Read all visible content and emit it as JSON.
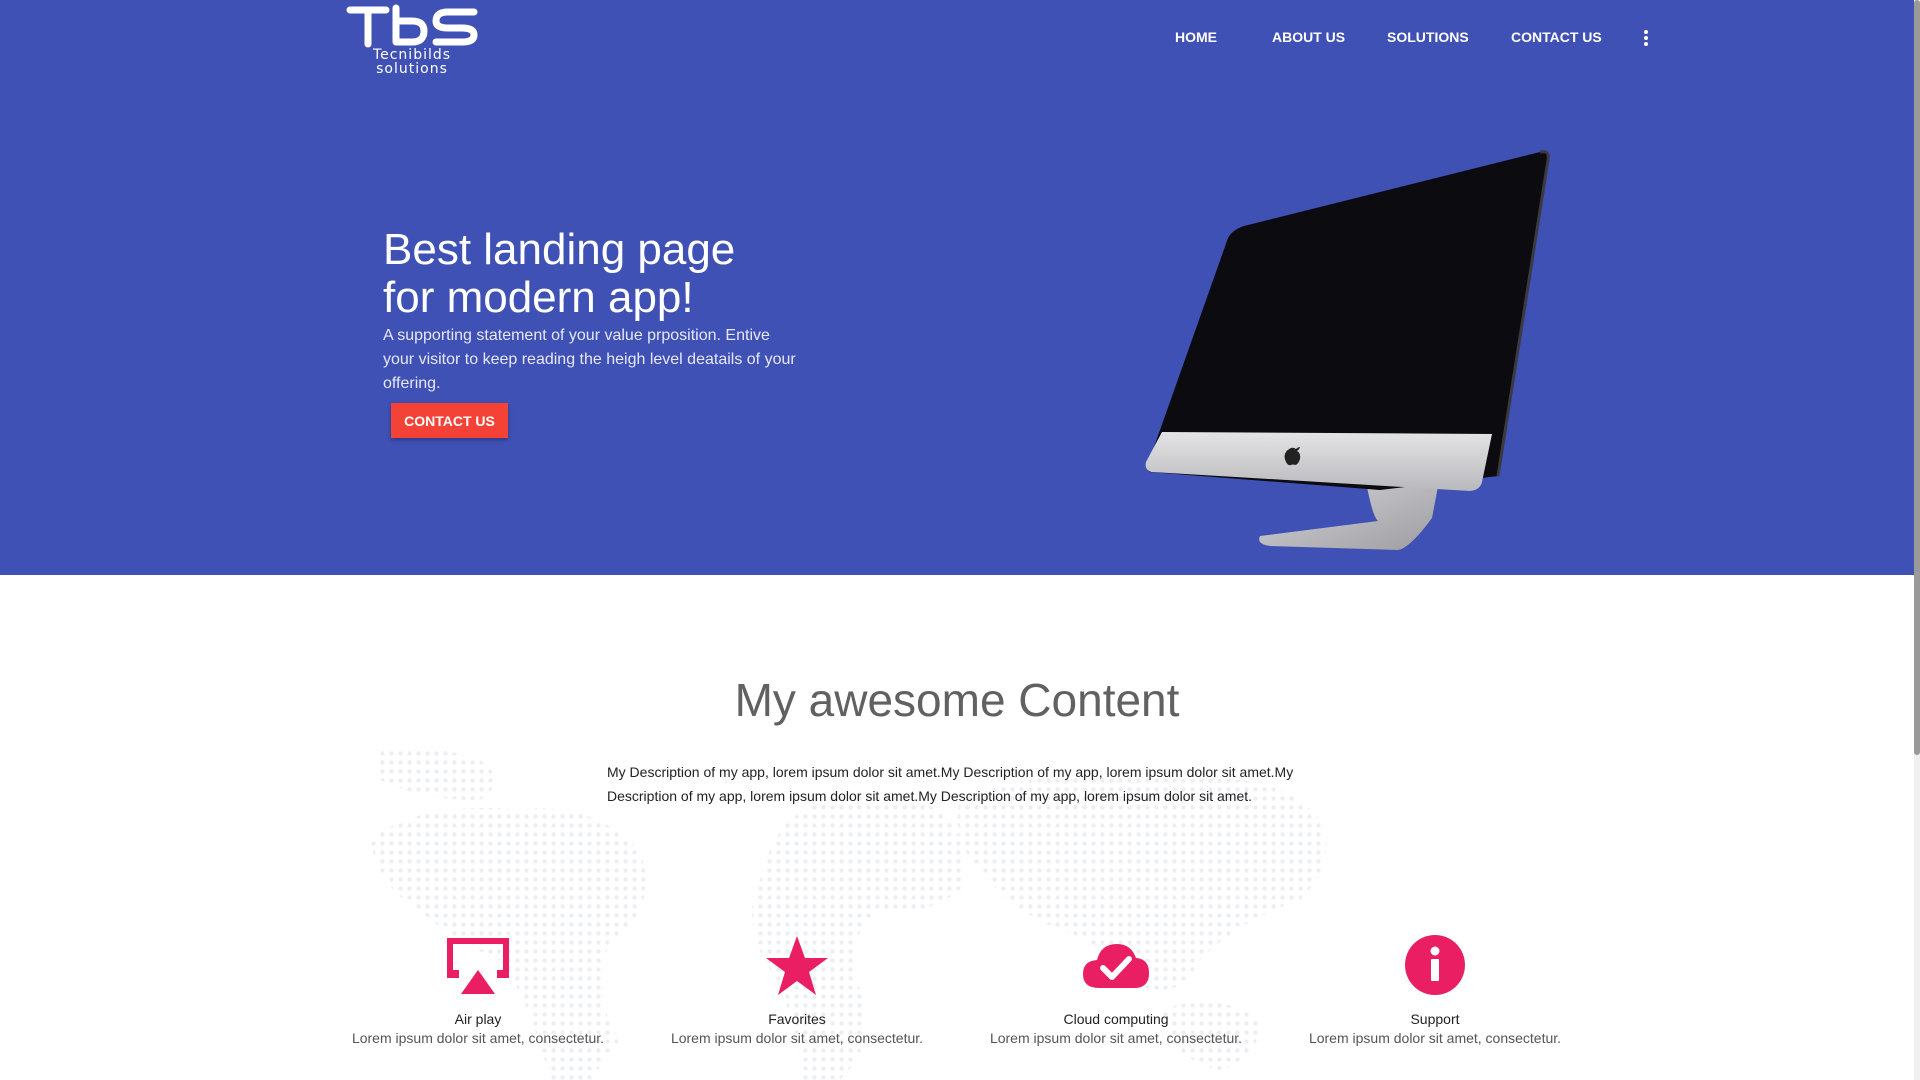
{
  "brand": {
    "logo_text": "TBS",
    "logo_line1": "Tecnibilds",
    "logo_line2": "solutions"
  },
  "nav": {
    "items": [
      "HOME",
      "ABOUT US",
      "SOLUTIONS",
      "CONTACT US"
    ],
    "more_icon": "more-vert-icon"
  },
  "hero": {
    "title_line1": "Best landing page",
    "title_line2": "for modern app!",
    "subtitle": "A supporting statement of your value prposition. Entive your visitor to keep reading the heigh level deatails of your offering.",
    "cta_label": "CONTACT US",
    "image": "imac-computer"
  },
  "content": {
    "title": "My awesome Content",
    "description": "My Description of my app, lorem ipsum dolor sit amet.My Description of my app, lorem ipsum dolor sit amet.My Description of my app, lorem ipsum dolor sit amet.My Description of my app, lorem ipsum dolor sit amet."
  },
  "features": [
    {
      "icon": "airplay-icon",
      "title": "Air play",
      "desc": "Lorem ipsum dolor sit amet, consectetur."
    },
    {
      "icon": "star-icon",
      "title": "Favorites",
      "desc": "Lorem ipsum dolor sit amet, consectetur."
    },
    {
      "icon": "cloud-done-icon",
      "title": "Cloud computing",
      "desc": "Lorem ipsum dolor sit amet, consectetur."
    },
    {
      "icon": "info-icon",
      "title": "Support",
      "desc": "Lorem ipsum dolor sit amet, consectetur."
    }
  ],
  "colors": {
    "primary": "#3f51b5",
    "accent": "#f44336",
    "icon": "#e91e63"
  }
}
